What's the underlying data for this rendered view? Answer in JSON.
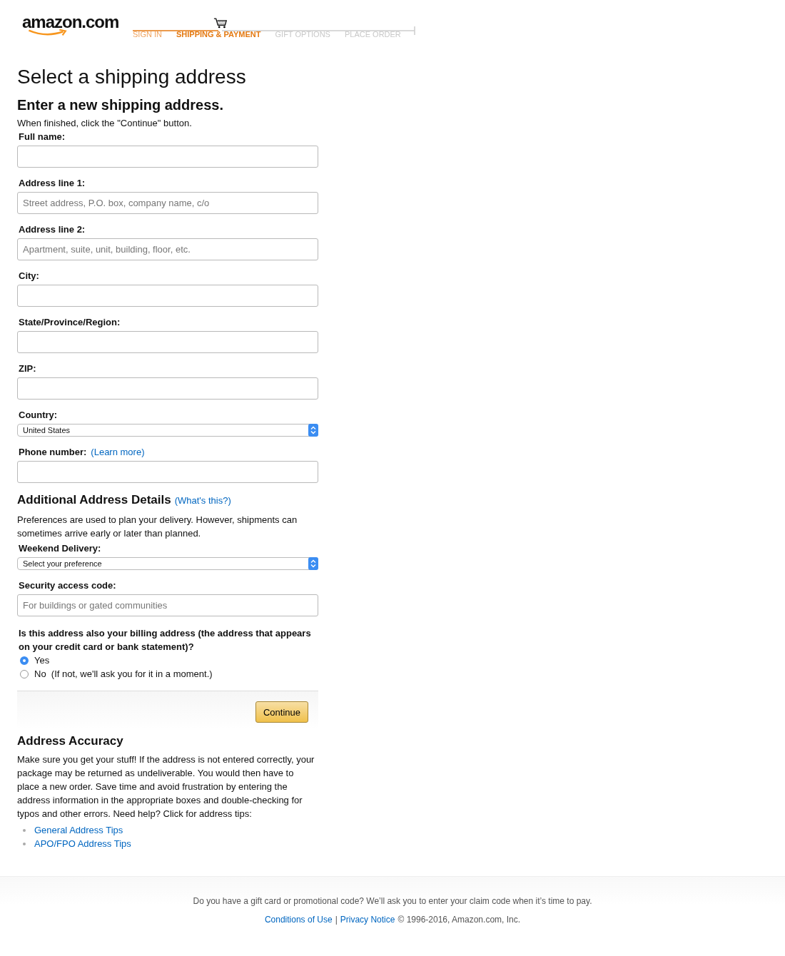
{
  "header": {
    "logo": "amazon.com",
    "steps": [
      {
        "label": "SIGN IN",
        "done": true,
        "selected": false
      },
      {
        "label": "SHIPPING & PAYMENT",
        "done": false,
        "selected": true
      },
      {
        "label": "GIFT OPTIONS",
        "done": false,
        "selected": false
      },
      {
        "label": "PLACE ORDER",
        "done": false,
        "selected": false
      }
    ]
  },
  "page_title": "Select a shipping address",
  "form": {
    "heading": "Enter a new shipping address.",
    "instruction": "When finished, click the \"Continue\" button.",
    "fields": [
      {
        "kind": "text",
        "label": "Full name:"
      },
      {
        "kind": "text",
        "label": "Address line 1:",
        "placeholder": "Street address, P.O. box, company name, c/o"
      },
      {
        "kind": "text",
        "label": "Address line 2:",
        "placeholder": "Apartment, suite, unit, building, floor, etc."
      },
      {
        "kind": "text",
        "label": "City:"
      },
      {
        "kind": "text",
        "label": "State/Province/Region:"
      },
      {
        "kind": "text",
        "label": "ZIP:"
      },
      {
        "kind": "select",
        "label": "Country:",
        "value": "United States"
      },
      {
        "kind": "text",
        "label": "Phone number:",
        "link": "(Learn more)"
      }
    ],
    "additional": {
      "heading": "Additional Address Details",
      "link": "(What's this?)",
      "description": "Preferences are used to plan your delivery. However, shipments can sometimes arrive early or later than planned.",
      "fields": [
        {
          "kind": "select",
          "label": "Weekend Delivery:",
          "value": "Select your preference"
        },
        {
          "kind": "text",
          "label": "Security access code:",
          "placeholder": "For buildings or gated communities"
        }
      ]
    },
    "billing_question": "Is this address also your billing address (the address that appears on your credit card or bank statement)?",
    "billing_options": [
      {
        "label": "Yes",
        "selected": true
      },
      {
        "label": "No  (If not, we'll ask you for it in a moment.)",
        "selected": false
      }
    ],
    "continue_button": "Continue"
  },
  "accuracy": {
    "heading": "Address Accuracy",
    "text": "Make sure you get your stuff! If the address is not entered correctly, your package may be returned as undeliverable. You would then have to place a new order. Save time and avoid frustration by entering the address information in the appropriate boxes and double-checking for typos and other errors. Need help? Click for address tips:",
    "links": [
      "General Address Tips",
      "APO/FPO Address Tips"
    ]
  },
  "footer": {
    "note": "Do you have a gift card or promotional code? We’ll ask you to enter your claim code when it’s time to pay.",
    "links": [
      "Conditions of Use",
      "Privacy Notice"
    ],
    "separator": "|",
    "copyright": "© 1996-2016, Amazon.com, Inc."
  }
}
